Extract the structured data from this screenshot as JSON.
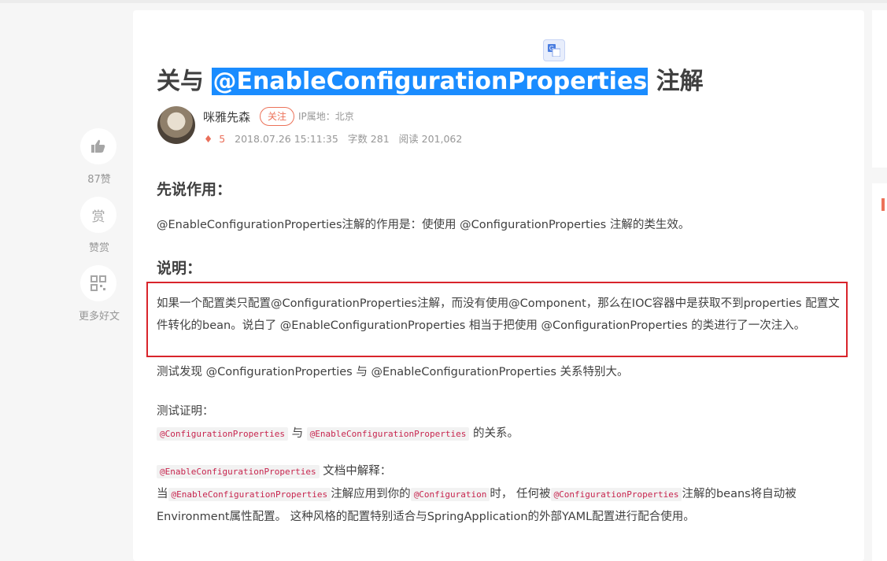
{
  "article": {
    "title_pre": "关与 ",
    "title_highlight": "@EnableConfigurationProperties",
    "title_post": " 注解",
    "author": "咪雅先森",
    "follow_label": "关注",
    "ip_location": "IP属地：北京",
    "diamond_count": "5",
    "date": "2018.07.26 15:11:35",
    "word_count": "字数 281",
    "read_count": "阅读 201,062"
  },
  "rail": {
    "like_count": "87赞",
    "reward_icon_text": "赏",
    "reward_label": "赞赏",
    "more_label": "更多好文"
  },
  "content": {
    "h_effect": "先说作用：",
    "effect_text": "@EnableConfigurationProperties注解的作用是：使使用 @ConfigurationProperties 注解的类生效。",
    "h_explain": "说明：",
    "explain_text": "如果一个配置类只配置@ConfigurationProperties注解，而没有使用@Component，那么在IOC容器中是获取不到properties 配置文件转化的bean。说白了 @EnableConfigurationProperties 相当于把使用 @ConfigurationProperties 的类进行了一次注入。",
    "test_found": "测试发现 @ConfigurationProperties 与 @EnableConfigurationProperties 关系特别大。",
    "test_proof": "测试证明：",
    "code_cp": "@ConfigurationProperties",
    "with": "与",
    "code_ecp": "@EnableConfigurationProperties",
    "relation": "的关系。",
    "doc_explain": "文档中解释：",
    "when": "当",
    "applied_to_your": "注解应用到你的",
    "code_configuration": "@Configuration",
    "time_any": "时， 任何被",
    "beans_auto": "注解的beans将自动被",
    "last_line": "Environment属性配置。 这种风格的配置特别适合与SpringApplication的外部YAML配置进行配合使用。"
  },
  "colors": {
    "accent": "#ec7259",
    "highlight": "#1a8cff",
    "box_border": "#d9242b",
    "code_text": "#c7254e"
  }
}
